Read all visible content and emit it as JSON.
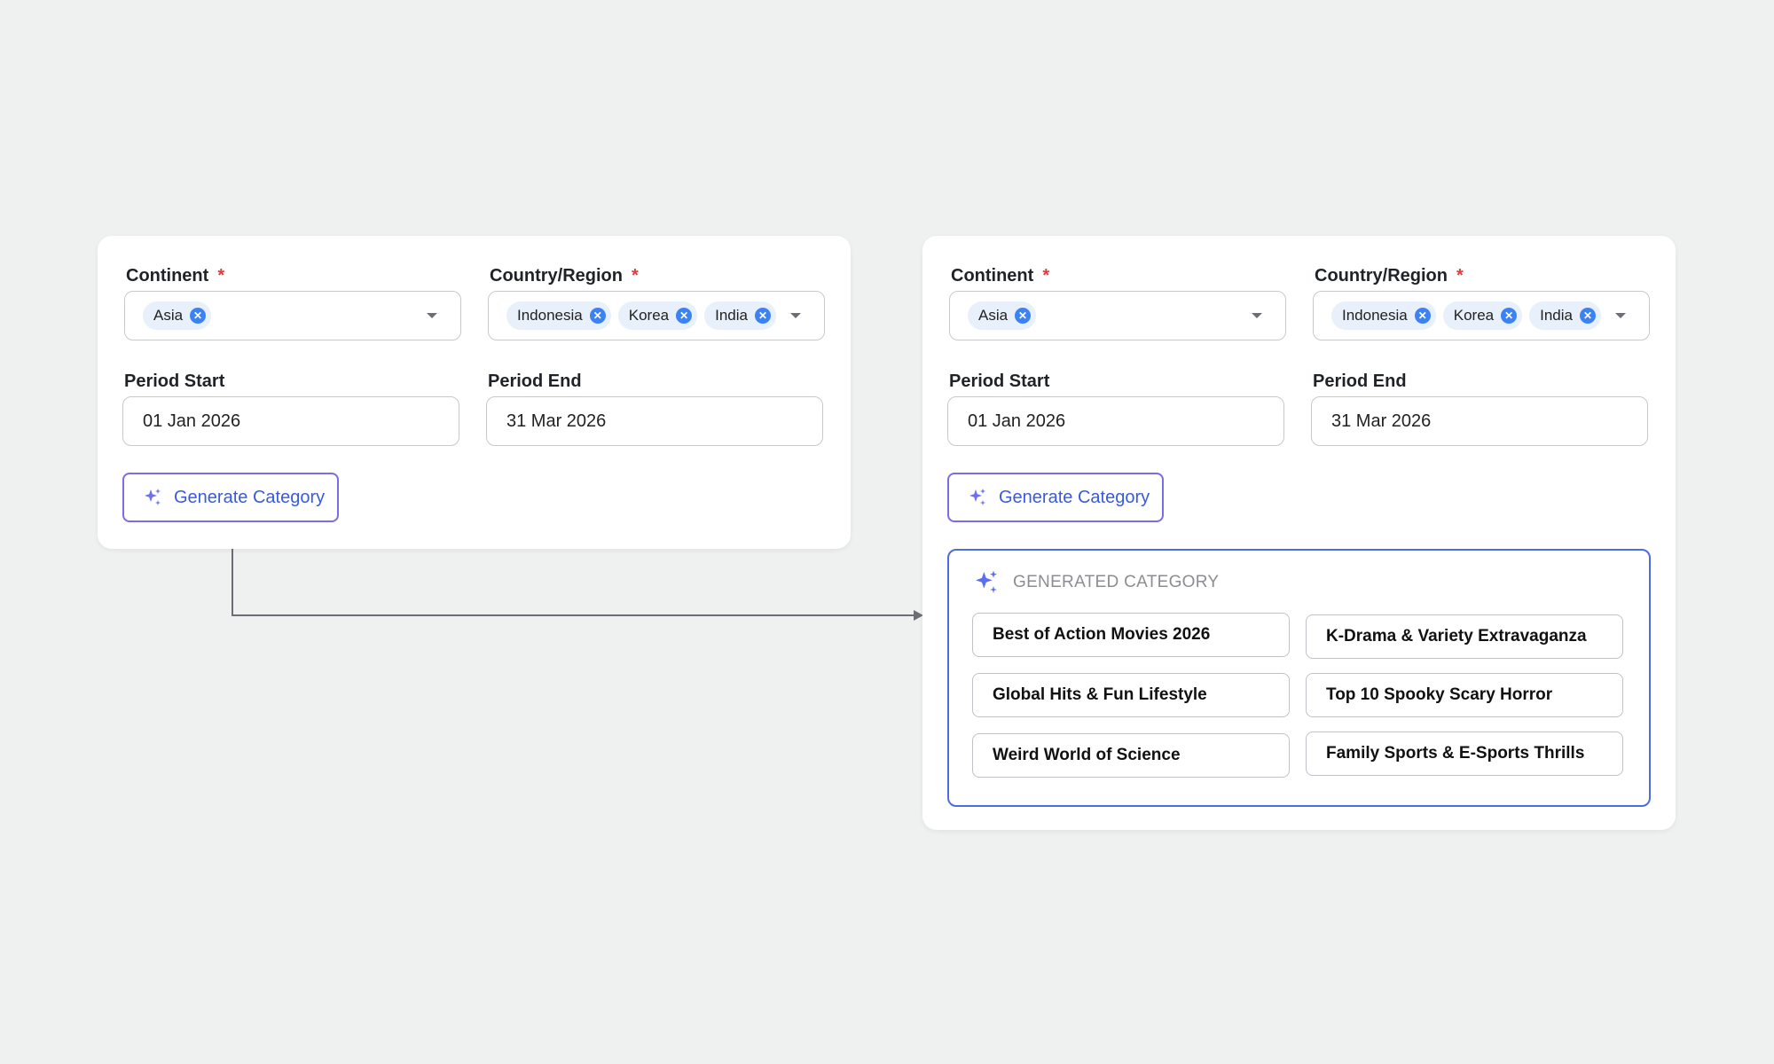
{
  "form": {
    "continent": {
      "label": "Continent",
      "required_mark": "*",
      "chips": [
        {
          "label": "Asia"
        }
      ]
    },
    "country": {
      "label": "Country/Region",
      "required_mark": "*",
      "chips": [
        {
          "label": "Indonesia"
        },
        {
          "label": "Korea"
        },
        {
          "label": "India"
        }
      ]
    },
    "period_start": {
      "label": "Period Start",
      "value": "01 Jan 2026"
    },
    "period_end": {
      "label": "Period End",
      "value": "31 Mar 2026"
    },
    "generate_button": {
      "label": "Generate Category",
      "icon": "sparkle-icon"
    }
  },
  "result": {
    "title": "GENERATED CATEGORY",
    "icon": "sparkle-icon",
    "categories": [
      "Best of Action Movies 2026",
      "K-Drama & Variety Extravaganza",
      "Global Hits & Fun Lifestyle",
      "Top 10 Spooky Scary Horror",
      "Weird World of Science",
      "Family Sports & E-Sports Thrills"
    ]
  },
  "colors": {
    "background": "#eff1f0",
    "accent_blue": "#3a5bd9",
    "accent_purple": "#7b6ce8",
    "required_red": "#e03b3b",
    "chip_bg": "#e8f0fb",
    "chip_remove": "#3b82f6"
  }
}
